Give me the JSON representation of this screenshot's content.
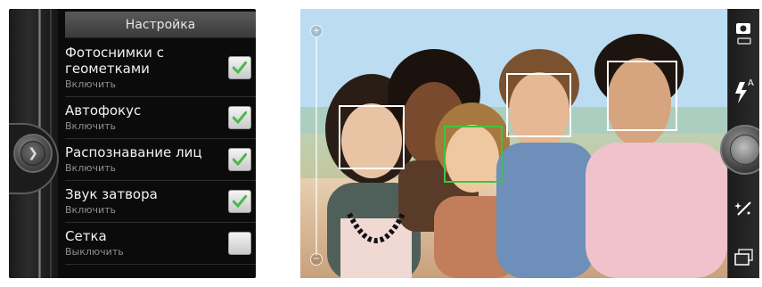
{
  "settings": {
    "title": "Настройка",
    "items": [
      {
        "title": "Фотоснимки с геометками",
        "status": "Включить",
        "checked": true
      },
      {
        "title": "Автофокус",
        "status": "Включить",
        "checked": true
      },
      {
        "title": "Распознавание лиц",
        "status": "Включить",
        "checked": true
      },
      {
        "title": "Звук затвора",
        "status": "Включить",
        "checked": true
      },
      {
        "title": "Сетка",
        "status": "Выключить",
        "checked": false
      }
    ]
  },
  "camera": {
    "flash_label": "A",
    "zoom_in_symbol": "+",
    "zoom_out_symbol": "−",
    "face_count": 5,
    "colors": {
      "face_box": "#ffffff",
      "focused_face_box": "#3fc43f",
      "check_mark": "#4bb84b"
    },
    "icons": [
      "camera-mode-icon",
      "flash-auto-icon",
      "shutter-button",
      "effects-icon",
      "gallery-icon"
    ]
  }
}
